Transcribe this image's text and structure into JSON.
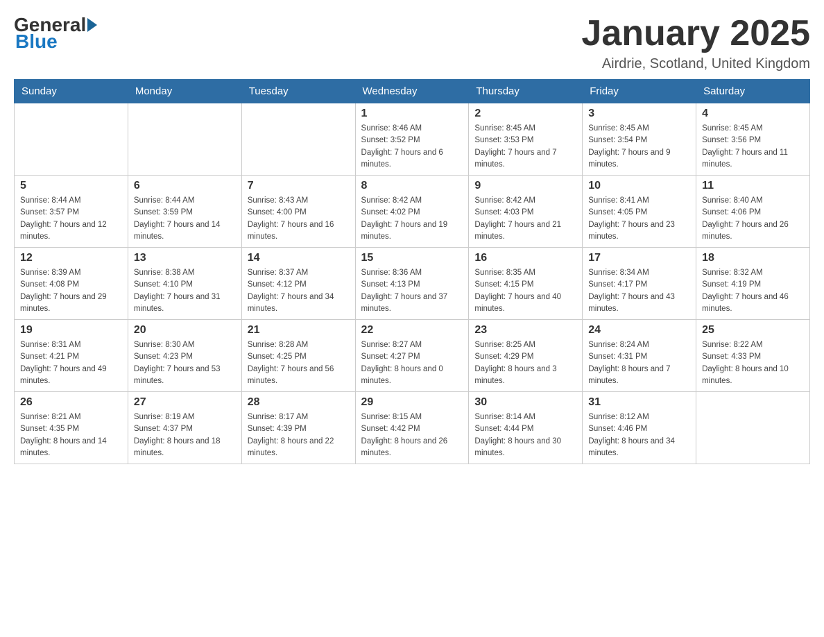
{
  "header": {
    "logo_general": "General",
    "logo_blue": "Blue",
    "month_title": "January 2025",
    "location": "Airdrie, Scotland, United Kingdom"
  },
  "weekdays": [
    "Sunday",
    "Monday",
    "Tuesday",
    "Wednesday",
    "Thursday",
    "Friday",
    "Saturday"
  ],
  "weeks": [
    [
      {
        "day": "",
        "info": ""
      },
      {
        "day": "",
        "info": ""
      },
      {
        "day": "",
        "info": ""
      },
      {
        "day": "1",
        "info": "Sunrise: 8:46 AM\nSunset: 3:52 PM\nDaylight: 7 hours and 6 minutes."
      },
      {
        "day": "2",
        "info": "Sunrise: 8:45 AM\nSunset: 3:53 PM\nDaylight: 7 hours and 7 minutes."
      },
      {
        "day": "3",
        "info": "Sunrise: 8:45 AM\nSunset: 3:54 PM\nDaylight: 7 hours and 9 minutes."
      },
      {
        "day": "4",
        "info": "Sunrise: 8:45 AM\nSunset: 3:56 PM\nDaylight: 7 hours and 11 minutes."
      }
    ],
    [
      {
        "day": "5",
        "info": "Sunrise: 8:44 AM\nSunset: 3:57 PM\nDaylight: 7 hours and 12 minutes."
      },
      {
        "day": "6",
        "info": "Sunrise: 8:44 AM\nSunset: 3:59 PM\nDaylight: 7 hours and 14 minutes."
      },
      {
        "day": "7",
        "info": "Sunrise: 8:43 AM\nSunset: 4:00 PM\nDaylight: 7 hours and 16 minutes."
      },
      {
        "day": "8",
        "info": "Sunrise: 8:42 AM\nSunset: 4:02 PM\nDaylight: 7 hours and 19 minutes."
      },
      {
        "day": "9",
        "info": "Sunrise: 8:42 AM\nSunset: 4:03 PM\nDaylight: 7 hours and 21 minutes."
      },
      {
        "day": "10",
        "info": "Sunrise: 8:41 AM\nSunset: 4:05 PM\nDaylight: 7 hours and 23 minutes."
      },
      {
        "day": "11",
        "info": "Sunrise: 8:40 AM\nSunset: 4:06 PM\nDaylight: 7 hours and 26 minutes."
      }
    ],
    [
      {
        "day": "12",
        "info": "Sunrise: 8:39 AM\nSunset: 4:08 PM\nDaylight: 7 hours and 29 minutes."
      },
      {
        "day": "13",
        "info": "Sunrise: 8:38 AM\nSunset: 4:10 PM\nDaylight: 7 hours and 31 minutes."
      },
      {
        "day": "14",
        "info": "Sunrise: 8:37 AM\nSunset: 4:12 PM\nDaylight: 7 hours and 34 minutes."
      },
      {
        "day": "15",
        "info": "Sunrise: 8:36 AM\nSunset: 4:13 PM\nDaylight: 7 hours and 37 minutes."
      },
      {
        "day": "16",
        "info": "Sunrise: 8:35 AM\nSunset: 4:15 PM\nDaylight: 7 hours and 40 minutes."
      },
      {
        "day": "17",
        "info": "Sunrise: 8:34 AM\nSunset: 4:17 PM\nDaylight: 7 hours and 43 minutes."
      },
      {
        "day": "18",
        "info": "Sunrise: 8:32 AM\nSunset: 4:19 PM\nDaylight: 7 hours and 46 minutes."
      }
    ],
    [
      {
        "day": "19",
        "info": "Sunrise: 8:31 AM\nSunset: 4:21 PM\nDaylight: 7 hours and 49 minutes."
      },
      {
        "day": "20",
        "info": "Sunrise: 8:30 AM\nSunset: 4:23 PM\nDaylight: 7 hours and 53 minutes."
      },
      {
        "day": "21",
        "info": "Sunrise: 8:28 AM\nSunset: 4:25 PM\nDaylight: 7 hours and 56 minutes."
      },
      {
        "day": "22",
        "info": "Sunrise: 8:27 AM\nSunset: 4:27 PM\nDaylight: 8 hours and 0 minutes."
      },
      {
        "day": "23",
        "info": "Sunrise: 8:25 AM\nSunset: 4:29 PM\nDaylight: 8 hours and 3 minutes."
      },
      {
        "day": "24",
        "info": "Sunrise: 8:24 AM\nSunset: 4:31 PM\nDaylight: 8 hours and 7 minutes."
      },
      {
        "day": "25",
        "info": "Sunrise: 8:22 AM\nSunset: 4:33 PM\nDaylight: 8 hours and 10 minutes."
      }
    ],
    [
      {
        "day": "26",
        "info": "Sunrise: 8:21 AM\nSunset: 4:35 PM\nDaylight: 8 hours and 14 minutes."
      },
      {
        "day": "27",
        "info": "Sunrise: 8:19 AM\nSunset: 4:37 PM\nDaylight: 8 hours and 18 minutes."
      },
      {
        "day": "28",
        "info": "Sunrise: 8:17 AM\nSunset: 4:39 PM\nDaylight: 8 hours and 22 minutes."
      },
      {
        "day": "29",
        "info": "Sunrise: 8:15 AM\nSunset: 4:42 PM\nDaylight: 8 hours and 26 minutes."
      },
      {
        "day": "30",
        "info": "Sunrise: 8:14 AM\nSunset: 4:44 PM\nDaylight: 8 hours and 30 minutes."
      },
      {
        "day": "31",
        "info": "Sunrise: 8:12 AM\nSunset: 4:46 PM\nDaylight: 8 hours and 34 minutes."
      },
      {
        "day": "",
        "info": ""
      }
    ]
  ]
}
